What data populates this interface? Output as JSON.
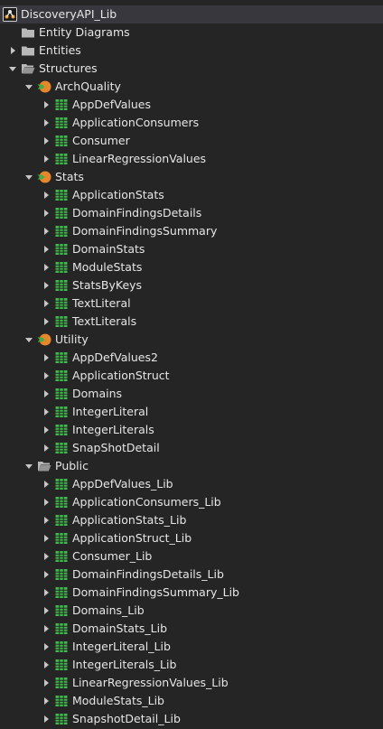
{
  "colors": {
    "background": "#252526",
    "selected_row": "#37373d",
    "text": "#e6e6e6",
    "folder": "#b8b8b8",
    "module_orange": "#e8862a",
    "module_green": "#3fae49",
    "table_green": "#3dbb4a"
  },
  "root": {
    "label": "DiscoveryAPI_Lib",
    "icon": "app-module-icon"
  },
  "items": [
    {
      "label": "Entity Diagrams",
      "icon": "folder-icon",
      "level": 1,
      "toggle": "none"
    },
    {
      "label": "Entities",
      "icon": "folder-icon",
      "level": 1,
      "toggle": "collapsed"
    },
    {
      "label": "Structures",
      "icon": "folder-open-icon",
      "level": 1,
      "toggle": "expanded"
    },
    {
      "label": "ArchQuality",
      "icon": "structure-module-icon",
      "level": 2,
      "toggle": "expanded"
    },
    {
      "label": "AppDefValues",
      "icon": "table-icon",
      "level": 3,
      "toggle": "collapsed"
    },
    {
      "label": "ApplicationConsumers",
      "icon": "table-icon",
      "level": 3,
      "toggle": "collapsed"
    },
    {
      "label": "Consumer",
      "icon": "table-icon",
      "level": 3,
      "toggle": "collapsed"
    },
    {
      "label": "LinearRegressionValues",
      "icon": "table-icon",
      "level": 3,
      "toggle": "collapsed"
    },
    {
      "label": "Stats",
      "icon": "structure-module-icon",
      "level": 2,
      "toggle": "expanded"
    },
    {
      "label": "ApplicationStats",
      "icon": "table-icon",
      "level": 3,
      "toggle": "collapsed"
    },
    {
      "label": "DomainFindingsDetails",
      "icon": "table-icon",
      "level": 3,
      "toggle": "collapsed"
    },
    {
      "label": "DomainFindingsSummary",
      "icon": "table-icon",
      "level": 3,
      "toggle": "collapsed"
    },
    {
      "label": "DomainStats",
      "icon": "table-icon",
      "level": 3,
      "toggle": "collapsed"
    },
    {
      "label": "ModuleStats",
      "icon": "table-icon",
      "level": 3,
      "toggle": "collapsed"
    },
    {
      "label": "StatsByKeys",
      "icon": "table-icon",
      "level": 3,
      "toggle": "collapsed"
    },
    {
      "label": "TextLiteral",
      "icon": "table-icon",
      "level": 3,
      "toggle": "collapsed"
    },
    {
      "label": "TextLiterals",
      "icon": "table-icon",
      "level": 3,
      "toggle": "collapsed"
    },
    {
      "label": "Utility",
      "icon": "structure-module-icon",
      "level": 2,
      "toggle": "expanded"
    },
    {
      "label": "AppDefValues2",
      "icon": "table-icon",
      "level": 3,
      "toggle": "collapsed"
    },
    {
      "label": "ApplicationStruct",
      "icon": "table-icon",
      "level": 3,
      "toggle": "collapsed"
    },
    {
      "label": "Domains",
      "icon": "table-icon",
      "level": 3,
      "toggle": "collapsed"
    },
    {
      "label": "IntegerLiteral",
      "icon": "table-icon",
      "level": 3,
      "toggle": "collapsed"
    },
    {
      "label": "IntegerLiterals",
      "icon": "table-icon",
      "level": 3,
      "toggle": "collapsed"
    },
    {
      "label": "SnapShotDetail",
      "icon": "table-icon",
      "level": 3,
      "toggle": "collapsed"
    },
    {
      "label": "Public",
      "icon": "folder-open-icon",
      "level": 2,
      "toggle": "expanded"
    },
    {
      "label": "AppDefValues_Lib",
      "icon": "table-icon",
      "level": 3,
      "toggle": "collapsed"
    },
    {
      "label": "ApplicationConsumers_Lib",
      "icon": "table-icon",
      "level": 3,
      "toggle": "collapsed"
    },
    {
      "label": "ApplicationStats_Lib",
      "icon": "table-icon",
      "level": 3,
      "toggle": "collapsed"
    },
    {
      "label": "ApplicationStruct_Lib",
      "icon": "table-icon",
      "level": 3,
      "toggle": "collapsed"
    },
    {
      "label": "Consumer_Lib",
      "icon": "table-icon",
      "level": 3,
      "toggle": "collapsed"
    },
    {
      "label": "DomainFindingsDetails_Lib",
      "icon": "table-icon",
      "level": 3,
      "toggle": "collapsed"
    },
    {
      "label": "DomainFindingsSummary_Lib",
      "icon": "table-icon",
      "level": 3,
      "toggle": "collapsed"
    },
    {
      "label": "Domains_Lib",
      "icon": "table-icon",
      "level": 3,
      "toggle": "collapsed"
    },
    {
      "label": "DomainStats_Lib",
      "icon": "table-icon",
      "level": 3,
      "toggle": "collapsed"
    },
    {
      "label": "IntegerLiteral_Lib",
      "icon": "table-icon",
      "level": 3,
      "toggle": "collapsed"
    },
    {
      "label": "IntegerLiterals_Lib",
      "icon": "table-icon",
      "level": 3,
      "toggle": "collapsed"
    },
    {
      "label": "LinearRegressionValues_Lib",
      "icon": "table-icon",
      "level": 3,
      "toggle": "collapsed"
    },
    {
      "label": "ModuleStats_Lib",
      "icon": "table-icon",
      "level": 3,
      "toggle": "collapsed"
    },
    {
      "label": "SnapshotDetail_Lib",
      "icon": "table-icon",
      "level": 3,
      "toggle": "collapsed"
    }
  ]
}
